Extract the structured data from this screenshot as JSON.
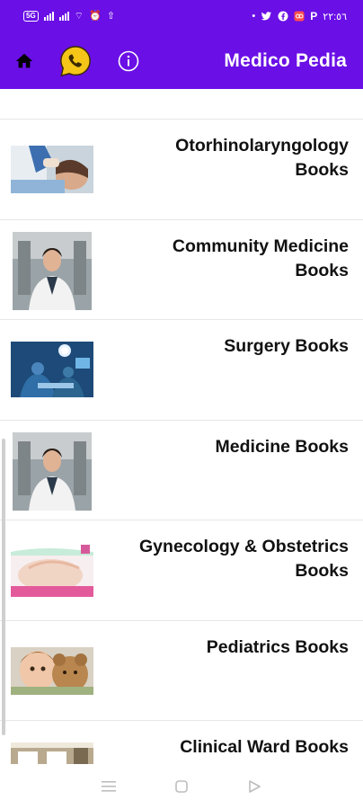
{
  "status_bar": {
    "left_chip": "5G",
    "time": "٢٢:٥٦",
    "notification_p": "P"
  },
  "app_bar": {
    "title": "Medico Pedia",
    "brand_color": "#6a0fe6",
    "icons": [
      "home-icon",
      "whatsapp-icon",
      "info-icon"
    ]
  },
  "list": {
    "items": [
      {
        "title": "Otorhinolaryngology Books",
        "thumb": "ent-exam-photo"
      },
      {
        "title": "Community Medicine Books",
        "thumb": "doctor-portrait-photo"
      },
      {
        "title": "Surgery Books",
        "thumb": "operating-room-photo"
      },
      {
        "title": "Medicine Books",
        "thumb": "doctor-portrait-photo"
      },
      {
        "title": "Gynecology & Obstetrics Books",
        "thumb": "pregnancy-photo"
      },
      {
        "title": "Pediatrics Books",
        "thumb": "child-with-teddy-photo"
      },
      {
        "title": "Clinical Ward  Books",
        "thumb": "hospital-ward-photo"
      }
    ]
  },
  "nav_bar": {
    "icons": [
      "recents-icon",
      "home-icon",
      "back-icon"
    ]
  }
}
